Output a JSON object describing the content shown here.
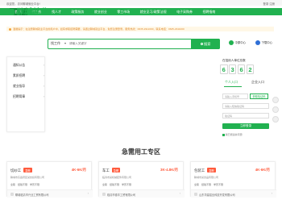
{
  "topbar": {
    "welcome": "欢迎您，访问聊城就业平台!",
    "login": "登录 注册"
  },
  "nav": {
    "items": [
      "首 页",
      "找工作",
      "找人才",
      "政策服务",
      "就业创业",
      "零工市场",
      "就业见习/政策法规",
      "电子采购券",
      "招聘指南"
    ]
  },
  "notice": {
    "text": "温馨提示：在注册聊城就业平台的用户中，如有求职招聘需要，请通过聊城就业平台，免费注册登录。服务热线：0635-2911000，联系电话：0635-2911000"
  },
  "header": {
    "logo_text": "聊城就业",
    "search": {
      "category": "找工作",
      "placeholder": "请输入关键字",
      "button": "搜索"
    },
    "right_items": [
      {
        "label": "中原中心",
        "icon": "location-icon",
        "color": "#21b150"
      },
      {
        "label": "下载中心",
        "icon": "download-icon",
        "color": "#2f6fd6"
      }
    ]
  },
  "sidebar": {
    "items": [
      "通知公告",
      "素质招聘",
      "就业指导",
      "招聘简章"
    ],
    "arrow": "›"
  },
  "login_panel": {
    "title_prefix": "在招用人单位总数",
    "digits": [
      "6",
      "3",
      "6",
      "2"
    ],
    "tabs": [
      "个人入口",
      "企业入口"
    ],
    "username_placeholder": "请输入手机号",
    "sms_placeholder": "请输入短信验证码",
    "code_button": "获取验证码",
    "captcha_placeholder": "验证码",
    "submit": "立即登录",
    "agree": "我已阅读并同意"
  },
  "section": {
    "title": "急需用工专区"
  },
  "jobs": [
    {
      "title": "切纱工",
      "tag": "急聘",
      "salary": "4K-6K/月",
      "company": "聊城市东昌府区某纺织有限公司",
      "meta": [
        "全职",
        "经验不限",
        "学历不限"
      ],
      "footer_company": "聊城临清市兴业工贸有限公司"
    },
    {
      "title": "车工",
      "tag": "急聘",
      "salary": "3K-4.8K/月",
      "company": "临清市某机械配件有限公司",
      "meta": [
        "全职",
        "经验不限",
        "学历不限"
      ],
      "footer_company": "临清市德丰工贸有限公司"
    },
    {
      "title": "包装工",
      "tag": "急聘",
      "salary": "4K-6K/月",
      "company": "聊城市某食品有限公司",
      "meta": [
        "全职",
        "经验不限",
        "学历不限"
      ],
      "footer_company": "山东华建铝业科技开发有限公司"
    }
  ],
  "colors": {
    "brand": "#21b150",
    "accent": "#ff5a3c",
    "notice": "#e08a2c"
  }
}
